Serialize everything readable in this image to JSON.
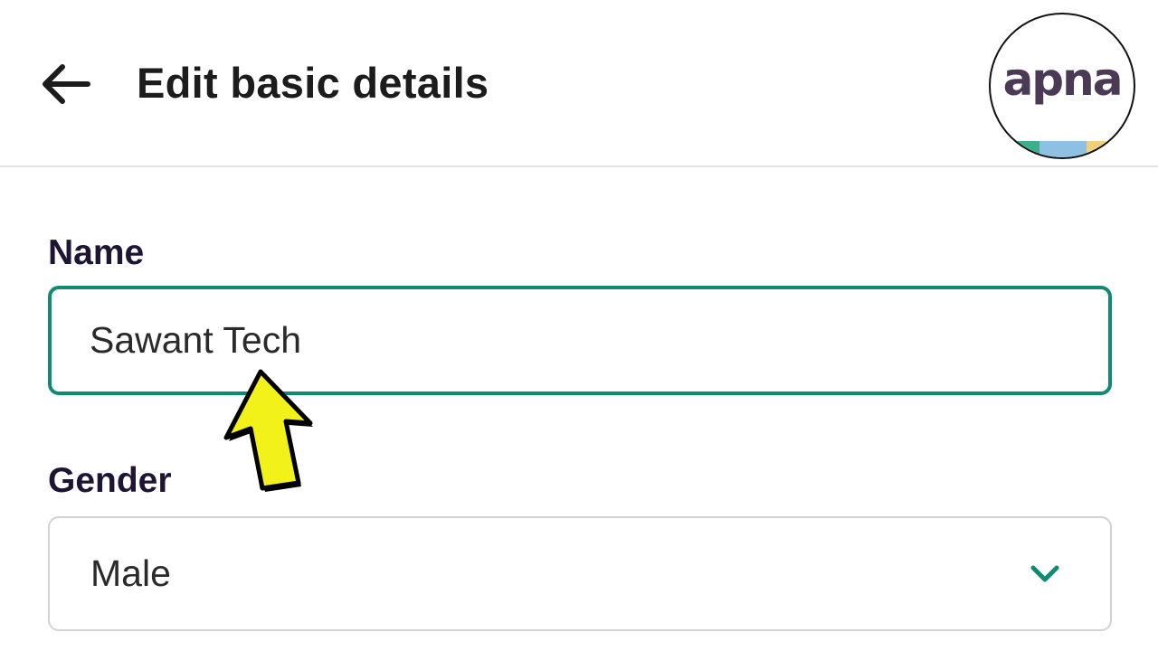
{
  "header": {
    "title": "Edit basic details",
    "back_icon": "arrow-left-icon"
  },
  "logo": {
    "text": "apna",
    "text_color": "#4a3a55",
    "stripe_colors": [
      "#3dae8a",
      "#8ec0e3",
      "#f2cf7a"
    ]
  },
  "form": {
    "name": {
      "label": "Name",
      "value": "Sawant Tech",
      "border_color": "#0f8a73",
      "focused": true
    },
    "gender": {
      "label": "Gender",
      "selected": "Male",
      "icon": "chevron-down-icon"
    }
  },
  "overlay": {
    "icon": "yellow-pointer-arrow-icon",
    "color": "#f2f21a"
  }
}
